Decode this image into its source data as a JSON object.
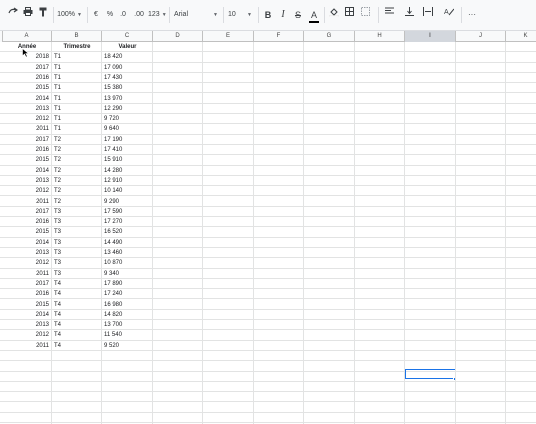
{
  "toolbar": {
    "zoom": "100%",
    "currency": "€",
    "percent": "%",
    "dec_decrease": ".0",
    "dec_increase": ".00",
    "more_formats": "123",
    "font": "Arial",
    "font_size": "10",
    "bold": "B",
    "italic": "I",
    "strike": "S",
    "text_color": "A",
    "more": "···"
  },
  "columns": [
    "A",
    "B",
    "C",
    "D",
    "E",
    "F",
    "G",
    "H",
    "I",
    "J",
    "K"
  ],
  "selected_column": "I",
  "headers": {
    "annee": "Année",
    "trimestre": "Trimestre",
    "valeur": "Valeur"
  },
  "rows": [
    [
      "2018",
      "T1",
      "18 420"
    ],
    [
      "2017",
      "T1",
      "17 090"
    ],
    [
      "2016",
      "T1",
      "17 430"
    ],
    [
      "2015",
      "T1",
      "15 380"
    ],
    [
      "2014",
      "T1",
      "13 970"
    ],
    [
      "2013",
      "T1",
      "12 290"
    ],
    [
      "2012",
      "T1",
      "9 720"
    ],
    [
      "2011",
      "T1",
      "9 640"
    ],
    [
      "2017",
      "T2",
      "17 190"
    ],
    [
      "2016",
      "T2",
      "17 410"
    ],
    [
      "2015",
      "T2",
      "15 910"
    ],
    [
      "2014",
      "T2",
      "14 280"
    ],
    [
      "2013",
      "T2",
      "12 910"
    ],
    [
      "2012",
      "T2",
      "10 140"
    ],
    [
      "2011",
      "T2",
      "9 290"
    ],
    [
      "2017",
      "T3",
      "17 590"
    ],
    [
      "2016",
      "T3",
      "17 270"
    ],
    [
      "2015",
      "T3",
      "16 520"
    ],
    [
      "2014",
      "T3",
      "14 490"
    ],
    [
      "2013",
      "T3",
      "13 460"
    ],
    [
      "2012",
      "T3",
      "10 870"
    ],
    [
      "2011",
      "T3",
      "9 340"
    ],
    [
      "2017",
      "T4",
      "17 890"
    ],
    [
      "2016",
      "T4",
      "17 240"
    ],
    [
      "2015",
      "T4",
      "16 980"
    ],
    [
      "2014",
      "T4",
      "14 820"
    ],
    [
      "2013",
      "T4",
      "13 700"
    ],
    [
      "2012",
      "T4",
      "11 540"
    ],
    [
      "2011",
      "T4",
      "9 520"
    ]
  ],
  "colors": {
    "accent": "#1a73e8",
    "selected_header": "#d3d7dd",
    "grid": "#e2e3e3"
  }
}
